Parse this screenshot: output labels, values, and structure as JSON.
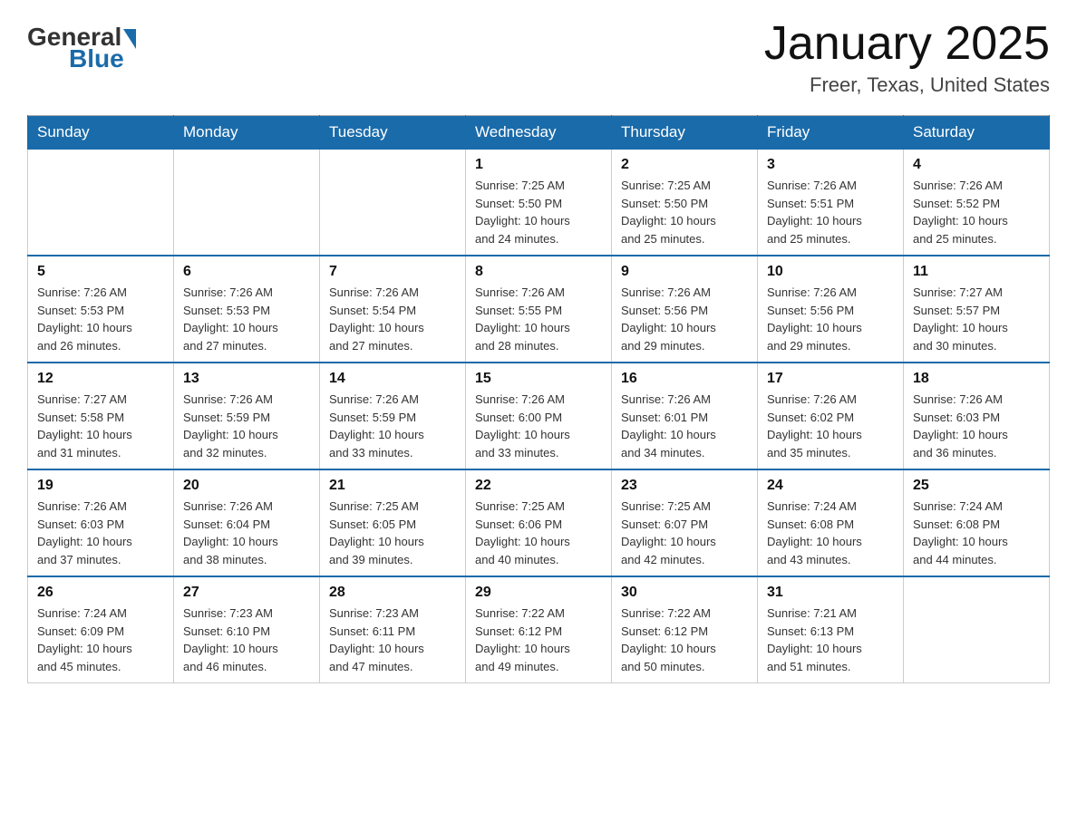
{
  "header": {
    "logo": {
      "general": "General",
      "blue": "Blue"
    },
    "title": "January 2025",
    "location": "Freer, Texas, United States"
  },
  "calendar": {
    "days_of_week": [
      "Sunday",
      "Monday",
      "Tuesday",
      "Wednesday",
      "Thursday",
      "Friday",
      "Saturday"
    ],
    "weeks": [
      [
        {
          "day": "",
          "info": ""
        },
        {
          "day": "",
          "info": ""
        },
        {
          "day": "",
          "info": ""
        },
        {
          "day": "1",
          "info": "Sunrise: 7:25 AM\nSunset: 5:50 PM\nDaylight: 10 hours\nand 24 minutes."
        },
        {
          "day": "2",
          "info": "Sunrise: 7:25 AM\nSunset: 5:50 PM\nDaylight: 10 hours\nand 25 minutes."
        },
        {
          "day": "3",
          "info": "Sunrise: 7:26 AM\nSunset: 5:51 PM\nDaylight: 10 hours\nand 25 minutes."
        },
        {
          "day": "4",
          "info": "Sunrise: 7:26 AM\nSunset: 5:52 PM\nDaylight: 10 hours\nand 25 minutes."
        }
      ],
      [
        {
          "day": "5",
          "info": "Sunrise: 7:26 AM\nSunset: 5:53 PM\nDaylight: 10 hours\nand 26 minutes."
        },
        {
          "day": "6",
          "info": "Sunrise: 7:26 AM\nSunset: 5:53 PM\nDaylight: 10 hours\nand 27 minutes."
        },
        {
          "day": "7",
          "info": "Sunrise: 7:26 AM\nSunset: 5:54 PM\nDaylight: 10 hours\nand 27 minutes."
        },
        {
          "day": "8",
          "info": "Sunrise: 7:26 AM\nSunset: 5:55 PM\nDaylight: 10 hours\nand 28 minutes."
        },
        {
          "day": "9",
          "info": "Sunrise: 7:26 AM\nSunset: 5:56 PM\nDaylight: 10 hours\nand 29 minutes."
        },
        {
          "day": "10",
          "info": "Sunrise: 7:26 AM\nSunset: 5:56 PM\nDaylight: 10 hours\nand 29 minutes."
        },
        {
          "day": "11",
          "info": "Sunrise: 7:27 AM\nSunset: 5:57 PM\nDaylight: 10 hours\nand 30 minutes."
        }
      ],
      [
        {
          "day": "12",
          "info": "Sunrise: 7:27 AM\nSunset: 5:58 PM\nDaylight: 10 hours\nand 31 minutes."
        },
        {
          "day": "13",
          "info": "Sunrise: 7:26 AM\nSunset: 5:59 PM\nDaylight: 10 hours\nand 32 minutes."
        },
        {
          "day": "14",
          "info": "Sunrise: 7:26 AM\nSunset: 5:59 PM\nDaylight: 10 hours\nand 33 minutes."
        },
        {
          "day": "15",
          "info": "Sunrise: 7:26 AM\nSunset: 6:00 PM\nDaylight: 10 hours\nand 33 minutes."
        },
        {
          "day": "16",
          "info": "Sunrise: 7:26 AM\nSunset: 6:01 PM\nDaylight: 10 hours\nand 34 minutes."
        },
        {
          "day": "17",
          "info": "Sunrise: 7:26 AM\nSunset: 6:02 PM\nDaylight: 10 hours\nand 35 minutes."
        },
        {
          "day": "18",
          "info": "Sunrise: 7:26 AM\nSunset: 6:03 PM\nDaylight: 10 hours\nand 36 minutes."
        }
      ],
      [
        {
          "day": "19",
          "info": "Sunrise: 7:26 AM\nSunset: 6:03 PM\nDaylight: 10 hours\nand 37 minutes."
        },
        {
          "day": "20",
          "info": "Sunrise: 7:26 AM\nSunset: 6:04 PM\nDaylight: 10 hours\nand 38 minutes."
        },
        {
          "day": "21",
          "info": "Sunrise: 7:25 AM\nSunset: 6:05 PM\nDaylight: 10 hours\nand 39 minutes."
        },
        {
          "day": "22",
          "info": "Sunrise: 7:25 AM\nSunset: 6:06 PM\nDaylight: 10 hours\nand 40 minutes."
        },
        {
          "day": "23",
          "info": "Sunrise: 7:25 AM\nSunset: 6:07 PM\nDaylight: 10 hours\nand 42 minutes."
        },
        {
          "day": "24",
          "info": "Sunrise: 7:24 AM\nSunset: 6:08 PM\nDaylight: 10 hours\nand 43 minutes."
        },
        {
          "day": "25",
          "info": "Sunrise: 7:24 AM\nSunset: 6:08 PM\nDaylight: 10 hours\nand 44 minutes."
        }
      ],
      [
        {
          "day": "26",
          "info": "Sunrise: 7:24 AM\nSunset: 6:09 PM\nDaylight: 10 hours\nand 45 minutes."
        },
        {
          "day": "27",
          "info": "Sunrise: 7:23 AM\nSunset: 6:10 PM\nDaylight: 10 hours\nand 46 minutes."
        },
        {
          "day": "28",
          "info": "Sunrise: 7:23 AM\nSunset: 6:11 PM\nDaylight: 10 hours\nand 47 minutes."
        },
        {
          "day": "29",
          "info": "Sunrise: 7:22 AM\nSunset: 6:12 PM\nDaylight: 10 hours\nand 49 minutes."
        },
        {
          "day": "30",
          "info": "Sunrise: 7:22 AM\nSunset: 6:12 PM\nDaylight: 10 hours\nand 50 minutes."
        },
        {
          "day": "31",
          "info": "Sunrise: 7:21 AM\nSunset: 6:13 PM\nDaylight: 10 hours\nand 51 minutes."
        },
        {
          "day": "",
          "info": ""
        }
      ]
    ]
  }
}
